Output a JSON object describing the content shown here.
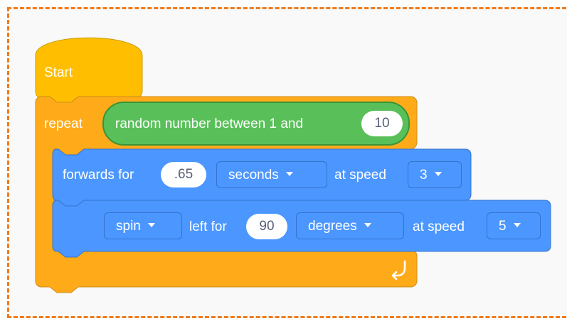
{
  "start_block": {
    "label": "Start"
  },
  "repeat_block": {
    "label": "repeat",
    "reporter": {
      "label": "random number between 1 and",
      "max_value": "10"
    },
    "loop_icon": "loop-arrow-icon"
  },
  "forward_block": {
    "label_prefix": "forwards for",
    "duration_value": ".65",
    "unit_dropdown": "seconds",
    "speed_label": "at speed",
    "speed_dropdown": "3"
  },
  "spin_block": {
    "direction_dropdown": "spin",
    "label_mid": "left for",
    "amount_value": "90",
    "unit_dropdown": "degrees",
    "speed_label": "at speed",
    "speed_dropdown": "5"
  },
  "colors": {
    "hat": "#ffbf00",
    "control": "#ffab19",
    "operator": "#59c059",
    "motion": "#4c97ff",
    "frame_border": "#f07c1d"
  }
}
